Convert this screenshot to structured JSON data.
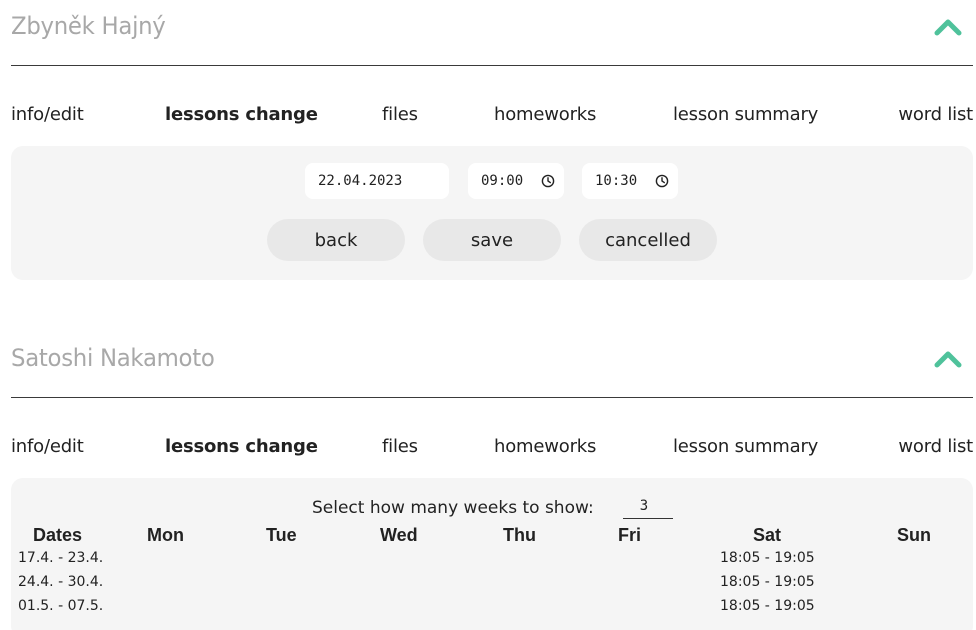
{
  "colors": {
    "accent": "#4fc29b",
    "panel": "#f5f5f5",
    "button": "#e8e8e8"
  },
  "students": [
    {
      "name": "Zbyněk Hajný",
      "tabs": [
        "info/edit",
        "lessons change",
        "files",
        "homeworks",
        "lesson summary",
        "word list"
      ],
      "active_tab": "lessons change",
      "lesson_change": {
        "date": "22.04.2023",
        "time_start": "09:00",
        "time_end": "10:30",
        "buttons": {
          "back": "back",
          "save": "save",
          "cancelled": "cancelled"
        }
      }
    },
    {
      "name": "Satoshi Nakamoto",
      "tabs": [
        "info/edit",
        "lessons change",
        "files",
        "homeworks",
        "lesson summary",
        "word list"
      ],
      "active_tab": "lessons change",
      "schedule": {
        "weeks_label": "Select how many weeks to show:",
        "weeks_value": "3",
        "headers": [
          "Dates",
          "Mon",
          "Tue",
          "Wed",
          "Thu",
          "Fri",
          "Sat",
          "Sun"
        ],
        "rows": [
          {
            "dates": "17.4. - 23.4.",
            "sat": "18:05 - 19:05"
          },
          {
            "dates": "24.4. - 30.4.",
            "sat": "18:05 - 19:05"
          },
          {
            "dates": "01.5. - 07.5.",
            "sat": "18:05 - 19:05"
          }
        ]
      }
    }
  ]
}
